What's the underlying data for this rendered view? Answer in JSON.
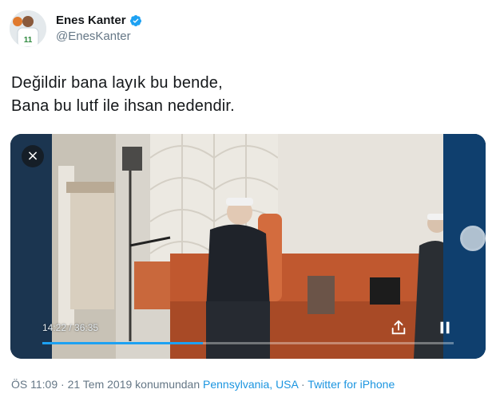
{
  "author": {
    "name": "Enes Kanter",
    "handle": "@EnesKanter",
    "verified": true,
    "avatar_icon": "avatar-basketball-player"
  },
  "tweet": {
    "lines": [
      "Değildir bana layık bu bende,",
      "Bana bu lutf ile ihsan nedendir."
    ]
  },
  "video": {
    "close_symbol": "×",
    "time": "14:22 / 36:35",
    "progress": 0.39,
    "colors": {
      "progress_fill": "#1da1f2",
      "overlay_bg": "#1b2a3a"
    },
    "icons": [
      "close-icon",
      "share-icon",
      "pause-icon",
      "scrub-handle-icon"
    ]
  },
  "meta": {
    "time": "ÖS 11:09",
    "separator1": " · ",
    "date": "21 Tem 2019",
    "location_prefix": " konumundan ",
    "location": "Pennsylvania, USA",
    "separator2": " · ",
    "source": "Twitter for iPhone"
  },
  "colors": {
    "text": "#14171a",
    "muted": "#657786",
    "link": "#1b95e0",
    "verified": "#1da1f2"
  }
}
